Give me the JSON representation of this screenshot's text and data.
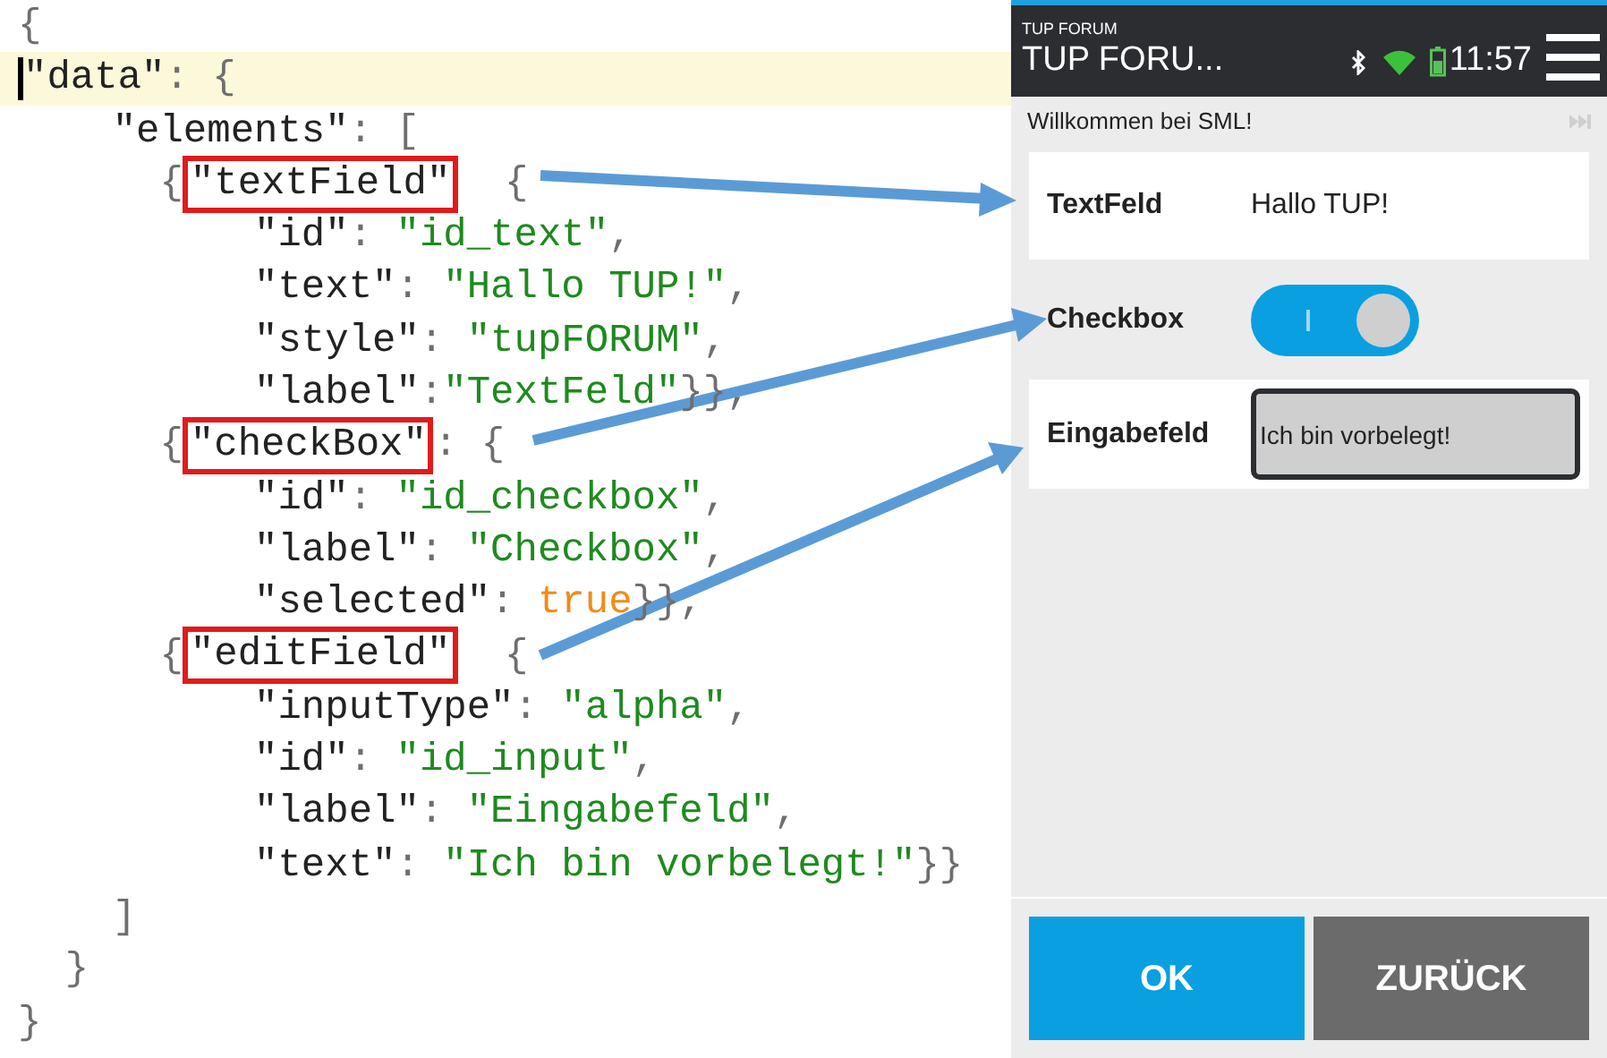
{
  "editor": {
    "lines": [
      {
        "highlighted": false,
        "cursor": false,
        "tokens": [
          {
            "kind": "punct",
            "text": "{"
          }
        ]
      },
      {
        "highlighted": true,
        "cursor": true,
        "tokens": [
          {
            "kind": "key",
            "text": "\"data\""
          },
          {
            "kind": "punct",
            "text": ": {"
          }
        ]
      },
      {
        "highlighted": false,
        "cursor": false,
        "tokens": [
          {
            "kind": "key",
            "text": "    \"elements\""
          },
          {
            "kind": "punct",
            "text": ": ["
          }
        ]
      },
      {
        "highlighted": false,
        "cursor": false,
        "tokens": [
          {
            "kind": "punct",
            "text": "      {"
          },
          {
            "kind": "key",
            "text": "\"textField\"",
            "boxed": true
          },
          {
            "kind": "punct",
            "text": "  {"
          }
        ]
      },
      {
        "highlighted": false,
        "cursor": false,
        "tokens": [
          {
            "kind": "key",
            "text": "          \"id\""
          },
          {
            "kind": "punct",
            "text": ": "
          },
          {
            "kind": "string",
            "text": "\"id_text\""
          },
          {
            "kind": "punct",
            "text": ","
          }
        ]
      },
      {
        "highlighted": false,
        "cursor": false,
        "tokens": [
          {
            "kind": "key",
            "text": "          \"text\""
          },
          {
            "kind": "punct",
            "text": ": "
          },
          {
            "kind": "string",
            "text": "\"Hallo TUP!\""
          },
          {
            "kind": "punct",
            "text": ","
          }
        ]
      },
      {
        "highlighted": false,
        "cursor": false,
        "tokens": [
          {
            "kind": "key",
            "text": "          \"style\""
          },
          {
            "kind": "punct",
            "text": ": "
          },
          {
            "kind": "string",
            "text": "\"tupFORUM\""
          },
          {
            "kind": "punct",
            "text": ","
          }
        ]
      },
      {
        "highlighted": false,
        "cursor": false,
        "tokens": [
          {
            "kind": "key",
            "text": "          \"label\""
          },
          {
            "kind": "punct",
            "text": ":"
          },
          {
            "kind": "string",
            "text": "\"TextFeld\""
          },
          {
            "kind": "punct",
            "text": "}},"
          }
        ]
      },
      {
        "highlighted": false,
        "cursor": false,
        "tokens": [
          {
            "kind": "punct",
            "text": "      {"
          },
          {
            "kind": "key",
            "text": "\"checkBox\"",
            "boxed": true
          },
          {
            "kind": "punct",
            "text": ": {"
          }
        ]
      },
      {
        "highlighted": false,
        "cursor": false,
        "tokens": [
          {
            "kind": "key",
            "text": "          \"id\""
          },
          {
            "kind": "punct",
            "text": ": "
          },
          {
            "kind": "string",
            "text": "\"id_checkbox\""
          },
          {
            "kind": "punct",
            "text": ","
          }
        ]
      },
      {
        "highlighted": false,
        "cursor": false,
        "tokens": [
          {
            "kind": "key",
            "text": "          \"label\""
          },
          {
            "kind": "punct",
            "text": ": "
          },
          {
            "kind": "string",
            "text": "\"Checkbox\""
          },
          {
            "kind": "punct",
            "text": ","
          }
        ]
      },
      {
        "highlighted": false,
        "cursor": false,
        "tokens": [
          {
            "kind": "key",
            "text": "          \"selected\""
          },
          {
            "kind": "punct",
            "text": ": "
          },
          {
            "kind": "bool",
            "text": "true"
          },
          {
            "kind": "punct",
            "text": "}},"
          }
        ]
      },
      {
        "highlighted": false,
        "cursor": false,
        "tokens": [
          {
            "kind": "punct",
            "text": "      {"
          },
          {
            "kind": "key",
            "text": "\"editField\"",
            "boxed": true
          },
          {
            "kind": "punct",
            "text": "  {"
          }
        ]
      },
      {
        "highlighted": false,
        "cursor": false,
        "tokens": [
          {
            "kind": "key",
            "text": "          \"inputType\""
          },
          {
            "kind": "punct",
            "text": ": "
          },
          {
            "kind": "string",
            "text": "\"alpha\""
          },
          {
            "kind": "punct",
            "text": ","
          }
        ]
      },
      {
        "highlighted": false,
        "cursor": false,
        "tokens": [
          {
            "kind": "key",
            "text": "          \"id\""
          },
          {
            "kind": "punct",
            "text": ": "
          },
          {
            "kind": "string",
            "text": "\"id_input\""
          },
          {
            "kind": "punct",
            "text": ","
          }
        ]
      },
      {
        "highlighted": false,
        "cursor": false,
        "tokens": [
          {
            "kind": "key",
            "text": "          \"label\""
          },
          {
            "kind": "punct",
            "text": ": "
          },
          {
            "kind": "string",
            "text": "\"Eingabefeld\""
          },
          {
            "kind": "punct",
            "text": ","
          }
        ]
      },
      {
        "highlighted": false,
        "cursor": false,
        "tokens": [
          {
            "kind": "key",
            "text": "          \"text\""
          },
          {
            "kind": "punct",
            "text": ": "
          },
          {
            "kind": "string",
            "text": "\"Ich bin vorbelegt!\""
          },
          {
            "kind": "punct",
            "text": "}}"
          }
        ]
      },
      {
        "highlighted": false,
        "cursor": false,
        "tokens": [
          {
            "kind": "punct",
            "text": "    ]"
          }
        ]
      },
      {
        "highlighted": false,
        "cursor": false,
        "tokens": [
          {
            "kind": "punct",
            "text": "  }"
          }
        ]
      },
      {
        "highlighted": false,
        "cursor": false,
        "tokens": [
          {
            "kind": "punct",
            "text": "}"
          }
        ]
      }
    ]
  },
  "phone": {
    "app_label": "TUP FORUM",
    "title": "TUP FORU...",
    "time": "11:57",
    "welcome": "Willkommen bei SML!",
    "rows": [
      {
        "kind": "text",
        "label": "TextFeld",
        "value": "Hallo TUP!"
      },
      {
        "kind": "switch",
        "label": "Checkbox",
        "on": true
      },
      {
        "kind": "input",
        "label": "Eingabefeld",
        "value": "Ich bin vorbelegt!"
      }
    ],
    "buttons": [
      {
        "kind": "primary",
        "label": "OK"
      },
      {
        "kind": "secondary",
        "label": "ZURÜCK"
      }
    ]
  }
}
